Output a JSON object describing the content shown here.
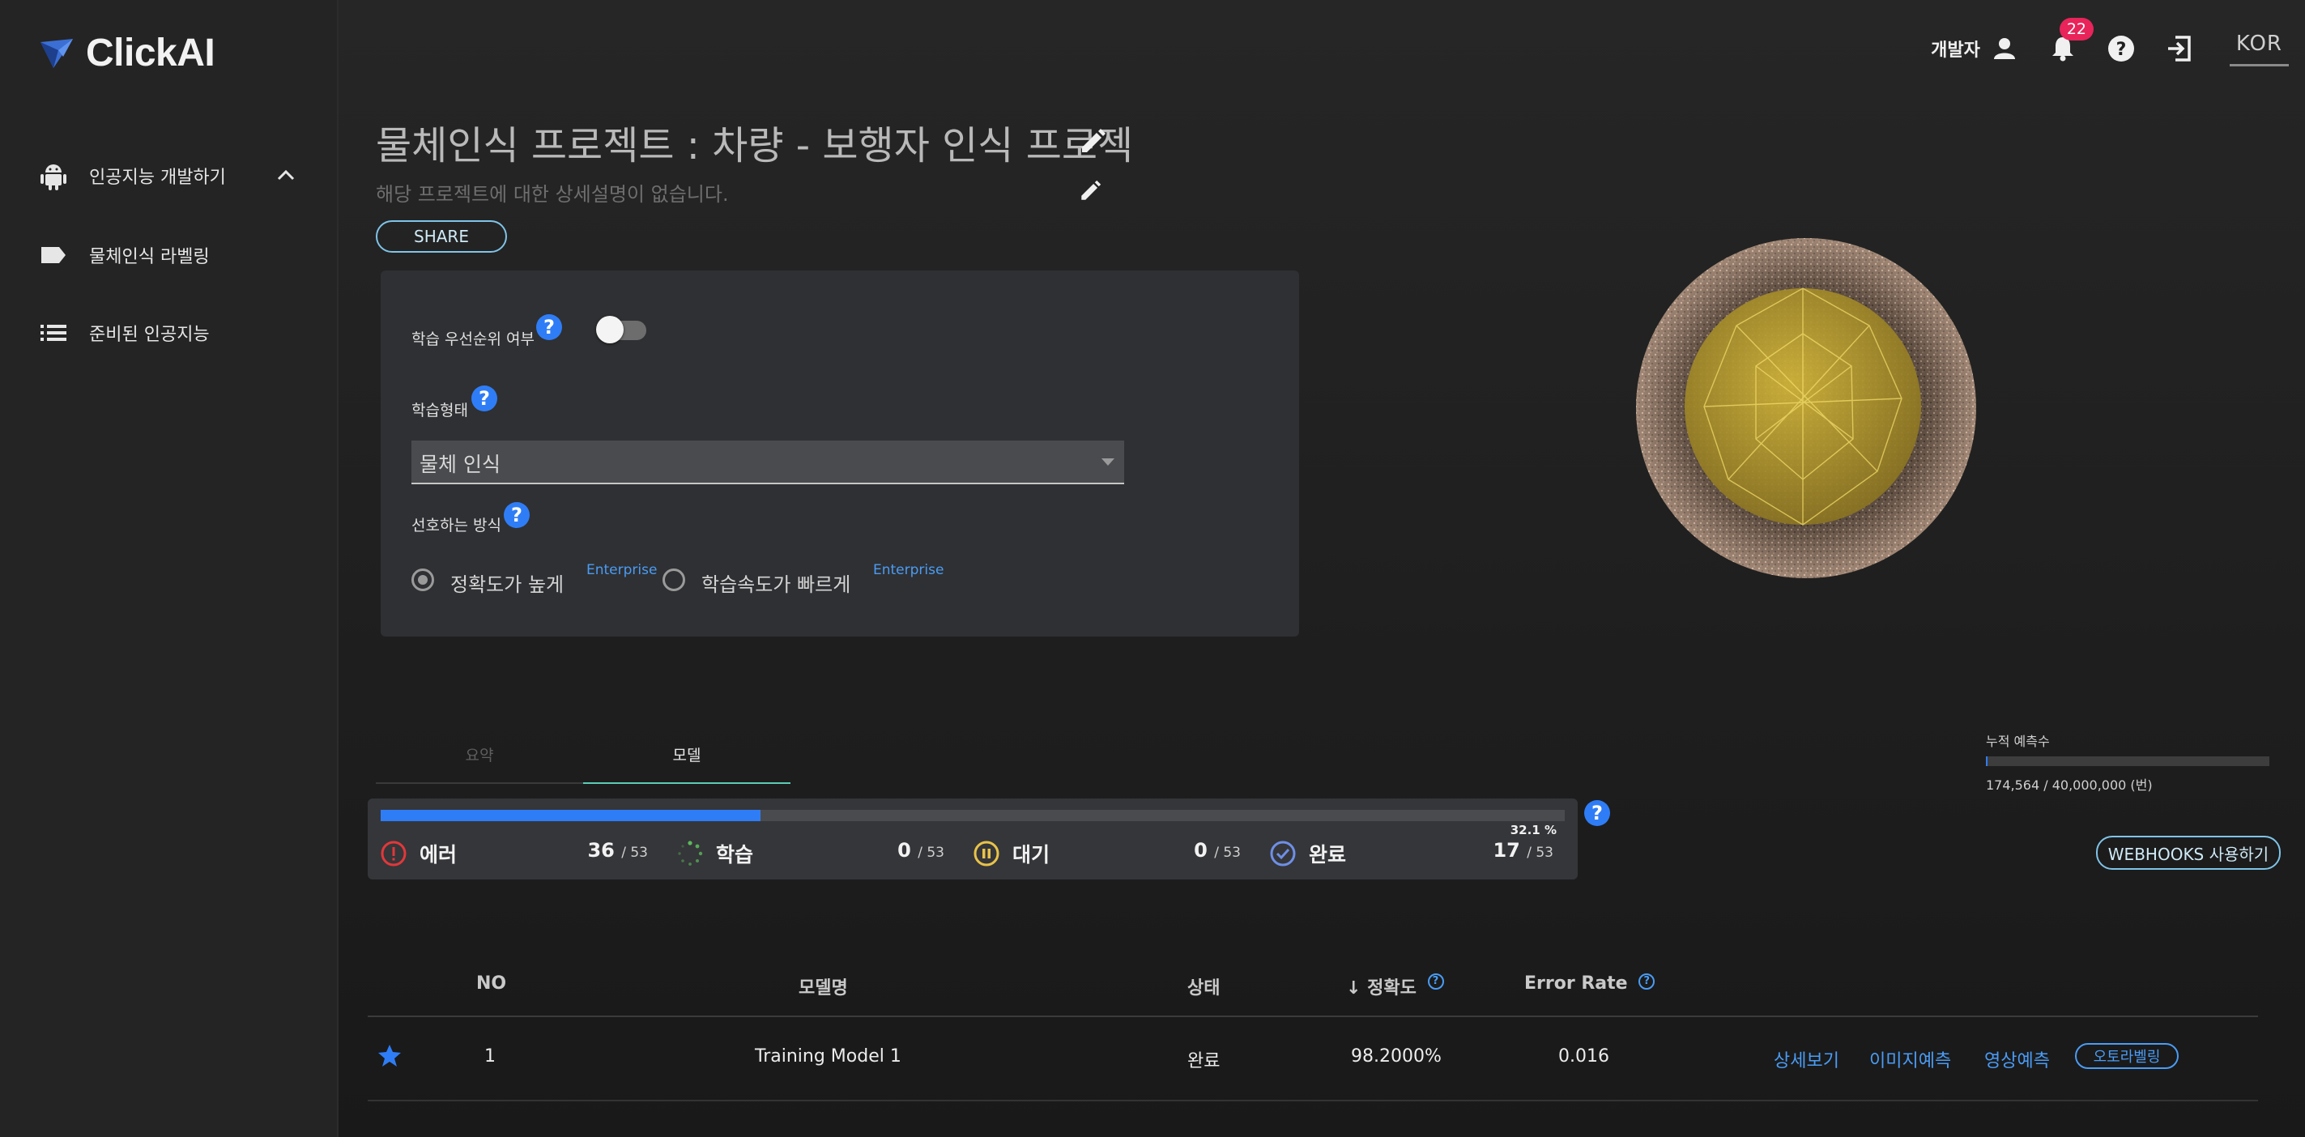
{
  "app": {
    "name": "ClickAI"
  },
  "sidebar": {
    "items": [
      {
        "label": "인공지능 개발하기",
        "icon": "android-icon",
        "expanded": true
      },
      {
        "label": "물체인식 라벨링",
        "icon": "label-tag-icon"
      },
      {
        "label": "준비된 인공지능",
        "icon": "list-icon"
      }
    ]
  },
  "topbar": {
    "user_label": "개발자",
    "notification_count": "22",
    "language": "KOR"
  },
  "project": {
    "title": "물체인식 프로젝트 : 차량 - 보행자 인식 프로젝",
    "description": "해당 프로젝트에 대한 상세설명이 없습니다.",
    "share_label": "SHARE"
  },
  "settings": {
    "priority_label": "학습 우선순위 여부",
    "priority_enabled": false,
    "training_type_label": "학습형태",
    "training_type_value": "물체 인식",
    "preference_label": "선호하는 방식",
    "options": [
      {
        "label": "정확도가 높게",
        "tag": "Enterprise",
        "selected": true
      },
      {
        "label": "학습속도가 빠르게",
        "tag": "Enterprise",
        "selected": false
      }
    ]
  },
  "tabs": [
    {
      "label": "요약",
      "active": false
    },
    {
      "label": "모델",
      "active": true
    }
  ],
  "usage": {
    "label": "누적 예측수",
    "count_text": "174,564 / 40,000,000 (번)",
    "fraction": 0.0044
  },
  "training_status": {
    "percent_text": "32.1 %",
    "progress": 0.321,
    "items": [
      {
        "name": "에러",
        "count": "36",
        "total": "/ 53",
        "color": "#e0383b",
        "icon": "error-icon"
      },
      {
        "name": "학습",
        "count": "0",
        "total": "/ 53",
        "color": "#5cb85c",
        "icon": "spinner-icon"
      },
      {
        "name": "대기",
        "count": "0",
        "total": "/ 53",
        "color": "#e8c34a",
        "icon": "pause-icon"
      },
      {
        "name": "완료",
        "count": "17",
        "total": "/ 53",
        "color": "#6e8fe6",
        "icon": "check-circle-icon"
      }
    ]
  },
  "webhooks_label": "WEBHOOKS 사용하기",
  "table": {
    "headers": {
      "no": "NO",
      "model": "모델명",
      "status": "상태",
      "accuracy": "정확도",
      "error_rate": "Error Rate"
    },
    "rows": [
      {
        "no": "1",
        "model": "Training Model 1",
        "status": "완료",
        "accuracy": "98.2000%",
        "error_rate": "0.016",
        "starred": true,
        "actions": [
          "상세보기",
          "이미지예측",
          "영상예측"
        ],
        "auto_label": "오토라벨링"
      }
    ]
  },
  "colors": {
    "accent": "#2f7df6",
    "link": "#4a9cf5",
    "share_border": "#7fc4e8",
    "badge": "#e8245a"
  }
}
